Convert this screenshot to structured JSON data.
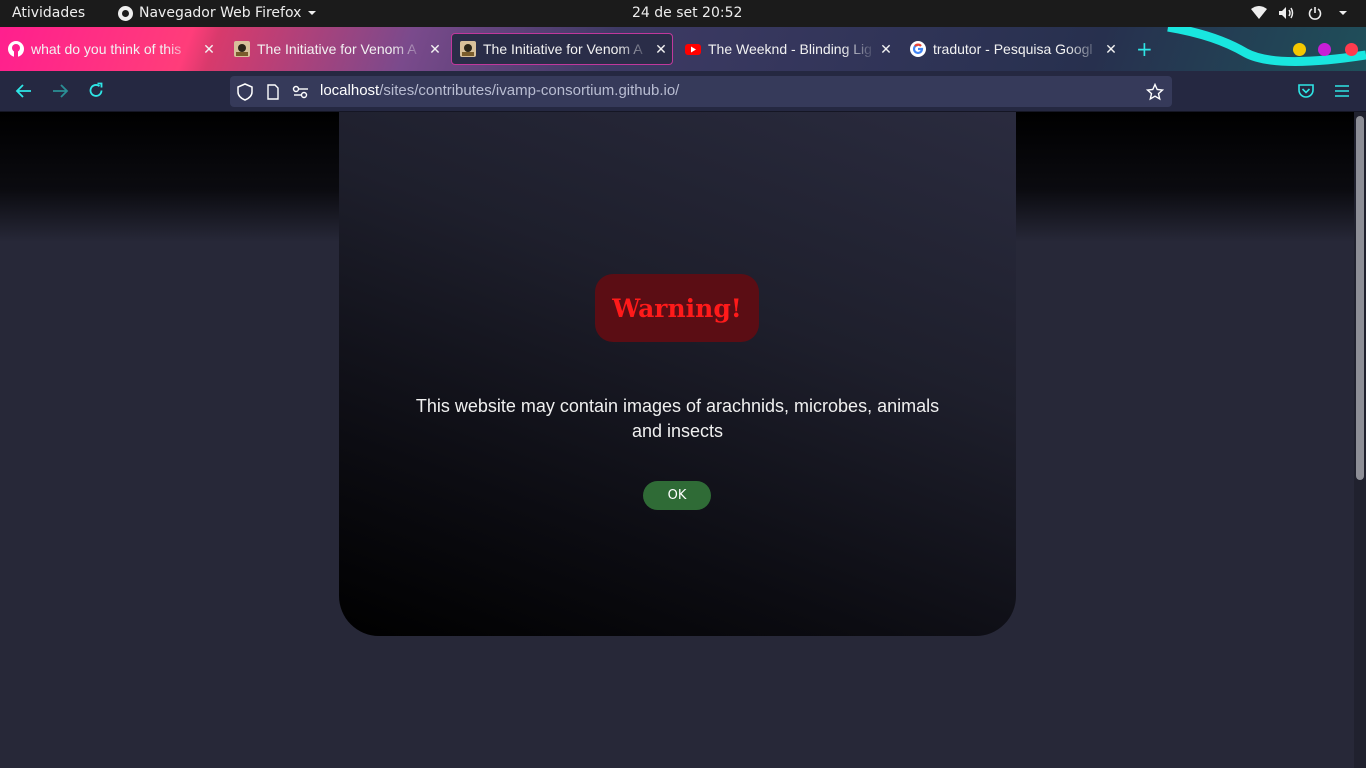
{
  "topbar": {
    "activities": "Atividades",
    "app_name": "Navegador Web Firefox",
    "clock": "24 de set  20:52",
    "tray_icons": [
      "wifi-icon",
      "volume-icon",
      "power-icon",
      "chevron-down-icon"
    ]
  },
  "tabs": [
    {
      "title": "what do you think of this",
      "favicon": "github-icon",
      "active": false
    },
    {
      "title": "The Initiative for Venom A",
      "favicon": "site-favicon",
      "active": false
    },
    {
      "title": "The Initiative for Venom A",
      "favicon": "site-favicon",
      "active": true
    },
    {
      "title": "The Weeknd - Blinding Lig",
      "favicon": "youtube-icon",
      "active": false
    },
    {
      "title": "tradutor - Pesquisa Googl",
      "favicon": "google-icon",
      "active": false
    }
  ],
  "window_controls": {
    "colors": [
      "#f5c800",
      "#c81fd6",
      "#ff3b4e"
    ]
  },
  "navbar": {
    "url_host": "localhost",
    "url_path": "/sites/contributes/ivamp-consortium.github.io/"
  },
  "page": {
    "warning_title": "Warning!",
    "warning_text": "This website may contain images of arachnids, microbes, animals and insects",
    "ok_label": "OK"
  },
  "colors": {
    "accent": "#2ee6e6",
    "warning_red": "#ff1a1a",
    "ok_green": "#2f6b36",
    "page_bg": "#272838"
  }
}
